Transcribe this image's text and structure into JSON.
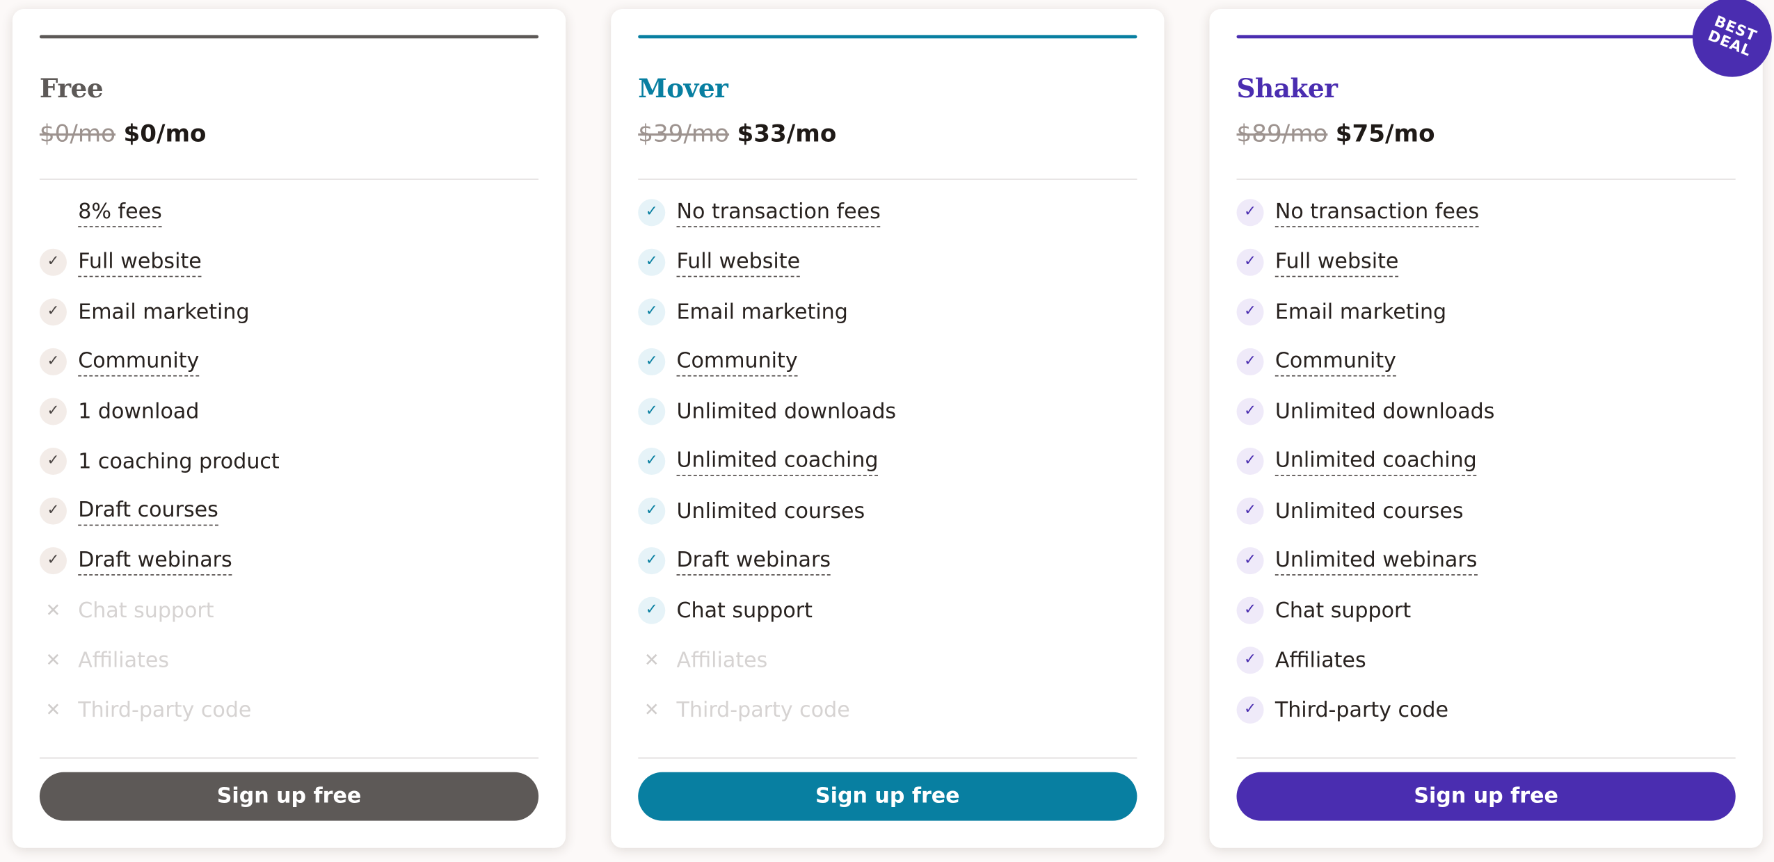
{
  "theme": {
    "free_color": "#5d5957",
    "mover_color": "#087fa1",
    "shaker_color": "#4a2db0",
    "page_background": "#fcf9f8"
  },
  "plans": [
    {
      "name": "Free",
      "old_price": "$0/mo",
      "new_price": "$0/mo",
      "cta_label": "Sign up free",
      "features": [
        {
          "label": "8% fees",
          "included": true,
          "icon": "none",
          "tooltip": true
        },
        {
          "label": "Full website",
          "included": true,
          "icon": "check-icon",
          "tooltip": true
        },
        {
          "label": "Email marketing",
          "included": true,
          "icon": "check-icon",
          "tooltip": false
        },
        {
          "label": "Community",
          "included": true,
          "icon": "check-icon",
          "tooltip": true
        },
        {
          "label": "1 download",
          "included": true,
          "icon": "check-icon",
          "tooltip": false
        },
        {
          "label": "1 coaching product",
          "included": true,
          "icon": "check-icon",
          "tooltip": false
        },
        {
          "label": "Draft courses",
          "included": true,
          "icon": "check-icon",
          "tooltip": true
        },
        {
          "label": "Draft webinars",
          "included": true,
          "icon": "check-icon",
          "tooltip": true
        },
        {
          "label": "Chat support",
          "included": false,
          "icon": "x-icon",
          "tooltip": false
        },
        {
          "label": "Affiliates",
          "included": false,
          "icon": "x-icon",
          "tooltip": false
        },
        {
          "label": "Third-party code",
          "included": false,
          "icon": "x-icon",
          "tooltip": false
        }
      ]
    },
    {
      "name": "Mover",
      "old_price": "$39/mo",
      "new_price": "$33/mo",
      "cta_label": "Sign up free",
      "features": [
        {
          "label": "No transaction fees",
          "included": true,
          "icon": "check-icon",
          "tooltip": true
        },
        {
          "label": "Full website",
          "included": true,
          "icon": "check-icon",
          "tooltip": true
        },
        {
          "label": "Email marketing",
          "included": true,
          "icon": "check-icon",
          "tooltip": false
        },
        {
          "label": "Community",
          "included": true,
          "icon": "check-icon",
          "tooltip": true
        },
        {
          "label": "Unlimited downloads",
          "included": true,
          "icon": "check-icon",
          "tooltip": false
        },
        {
          "label": "Unlimited coaching",
          "included": true,
          "icon": "check-icon",
          "tooltip": true
        },
        {
          "label": "Unlimited courses",
          "included": true,
          "icon": "check-icon",
          "tooltip": false
        },
        {
          "label": "Draft webinars",
          "included": true,
          "icon": "check-icon",
          "tooltip": true
        },
        {
          "label": "Chat support",
          "included": true,
          "icon": "check-icon",
          "tooltip": false
        },
        {
          "label": "Affiliates",
          "included": false,
          "icon": "x-icon",
          "tooltip": false
        },
        {
          "label": "Third-party code",
          "included": false,
          "icon": "x-icon",
          "tooltip": false
        }
      ]
    },
    {
      "name": "Shaker",
      "old_price": "$89/mo",
      "new_price": "$75/mo",
      "cta_label": "Sign up free",
      "badge": "BEST DEAL",
      "badge_line1": "BEST",
      "badge_line2": "DEAL",
      "features": [
        {
          "label": "No transaction fees",
          "included": true,
          "icon": "check-icon",
          "tooltip": true
        },
        {
          "label": "Full website",
          "included": true,
          "icon": "check-icon",
          "tooltip": true
        },
        {
          "label": "Email marketing",
          "included": true,
          "icon": "check-icon",
          "tooltip": false
        },
        {
          "label": "Community",
          "included": true,
          "icon": "check-icon",
          "tooltip": true
        },
        {
          "label": "Unlimited downloads",
          "included": true,
          "icon": "check-icon",
          "tooltip": false
        },
        {
          "label": "Unlimited coaching",
          "included": true,
          "icon": "check-icon",
          "tooltip": true
        },
        {
          "label": "Unlimited courses",
          "included": true,
          "icon": "check-icon",
          "tooltip": false
        },
        {
          "label": "Unlimited webinars",
          "included": true,
          "icon": "check-icon",
          "tooltip": true
        },
        {
          "label": "Chat support",
          "included": true,
          "icon": "check-icon",
          "tooltip": false
        },
        {
          "label": "Affiliates",
          "included": true,
          "icon": "check-icon",
          "tooltip": false
        },
        {
          "label": "Third-party code",
          "included": true,
          "icon": "check-icon",
          "tooltip": false
        }
      ]
    }
  ]
}
